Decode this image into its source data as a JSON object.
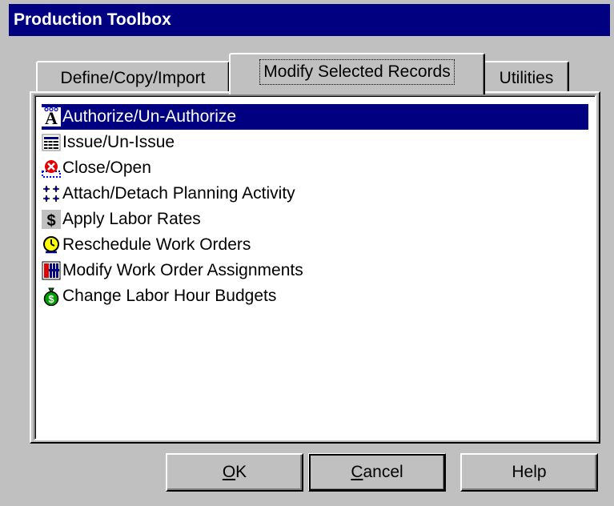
{
  "window": {
    "title": "Production Toolbox"
  },
  "tabs": [
    {
      "label": "Define/Copy/Import"
    },
    {
      "label": "Modify Selected Records",
      "active": true
    },
    {
      "label": "Utilities"
    }
  ],
  "list": {
    "items": [
      {
        "label": "Authorize/Un-Authorize",
        "icon": "authorize-icon",
        "selected": true
      },
      {
        "label": "Issue/Un-Issue",
        "icon": "issue-icon"
      },
      {
        "label": "Close/Open",
        "icon": "close-open-icon"
      },
      {
        "label": "Attach/Detach Planning Activity",
        "icon": "attach-detach-icon"
      },
      {
        "label": "Apply Labor Rates",
        "icon": "dollar-icon"
      },
      {
        "label": "Reschedule Work Orders",
        "icon": "clock-icon"
      },
      {
        "label": "Modify Work Order Assignments",
        "icon": "assignments-icon"
      },
      {
        "label": "Change Labor Hour Budgets",
        "icon": "money-bag-icon"
      }
    ]
  },
  "buttons": {
    "ok": {
      "mnemonic": "O",
      "rest": "K"
    },
    "cancel": {
      "mnemonic": "C",
      "rest": "ancel"
    },
    "help": {
      "label": "Help"
    }
  },
  "colors": {
    "titlebar": "#000080",
    "selection": "#000080",
    "face": "#c0c0c0"
  }
}
